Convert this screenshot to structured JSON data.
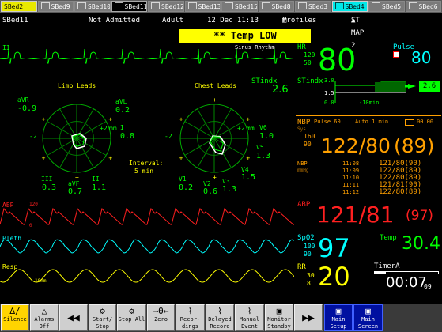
{
  "tabs": [
    {
      "label": "SBed2",
      "style": "yellow"
    },
    {
      "label": "SBed9",
      "style": "gray"
    },
    {
      "label": "SBed10",
      "style": "gray"
    },
    {
      "label": "SBed11",
      "style": "active"
    },
    {
      "label": "SBed12",
      "style": "gray"
    },
    {
      "label": "SBed13",
      "style": "gray"
    },
    {
      "label": "SBed15",
      "style": "gray"
    },
    {
      "label": "SBed8",
      "style": "gray"
    },
    {
      "label": "SBed3",
      "style": "gray"
    },
    {
      "label": "SBed4",
      "style": "cyan"
    },
    {
      "label": "SBed5",
      "style": "gray"
    },
    {
      "label": "SBed6",
      "style": "gray"
    }
  ],
  "status": {
    "bed": "SBed11",
    "admit": "Not Admitted",
    "category": "Adult",
    "datetime": "12 Dec 11:13",
    "profiles": "Profiles",
    "st_map": "ST MAP 2"
  },
  "alarm": "** Temp   LOW",
  "ecg": {
    "lead": "II",
    "rhythm": "Sinus Rhythm"
  },
  "st_map": {
    "limb_title": "Limb Leads",
    "chest_title": "Chest Leads",
    "avr_label": "aVR",
    "avr_val": "-0.9",
    "avl_label": "aVL",
    "avl_val": "0.2",
    "i_label": "I",
    "i_val": "0.8",
    "iii_label": "III",
    "iii_val": "0.3",
    "avf_label": "aVF",
    "avf_val": "0.7",
    "ii_label": "II",
    "ii_val": "1.1",
    "v1_label": "V1",
    "v1_val": "0.2",
    "v2_label": "V2",
    "v2_val": "0.6",
    "v3_label": "V3",
    "v3_val": "1.3",
    "v4_label": "V4",
    "v4_val": "1.5",
    "v5_label": "V5",
    "v5_val": "1.3",
    "v6_label": "V6",
    "v6_val": "1.0",
    "scale_neg": "-2",
    "scale_pos": "+2",
    "scale_unit": "mm",
    "interval_label": "Interval:",
    "interval_value": "5 min"
  },
  "hr": {
    "label": "HR",
    "high": "120",
    "low": "50",
    "value": "80"
  },
  "pulse": {
    "label": "Pulse",
    "value": "80"
  },
  "stindx": {
    "label": "STindx",
    "value": "2.6",
    "trend_label": "STindx",
    "trend_top": "3.0",
    "trend_mid": "1.5",
    "trend_bottom": "0.0",
    "trend_time": "-10min",
    "trend_value": "2.6"
  },
  "nbp": {
    "label": "NBP",
    "pulse": "Pulse 60",
    "mode": "Auto 1 min",
    "sys_label": "Sys.",
    "high": "160",
    "low": "90",
    "value": "122/80",
    "mean": "(89)",
    "timer_label": "00:00",
    "history_label": "NBP",
    "history_unit": "mmHg",
    "history": [
      {
        "time": "11:08",
        "value": "121/80(90)"
      },
      {
        "time": "11:09",
        "value": "122/80(89)"
      },
      {
        "time": "11:10",
        "value": "122/80(89)"
      },
      {
        "time": "11:11",
        "value": "121/81(90)"
      },
      {
        "time": "11:12",
        "value": "122/80(89)"
      }
    ]
  },
  "abp": {
    "wave_label": "ABP",
    "scale_top": "120",
    "scale_bottom": "0",
    "label": "ABP",
    "value": "121/81",
    "mean": "(97)"
  },
  "pleth": {
    "label": "Pleth"
  },
  "spo2": {
    "label": "SpO2",
    "high": "100",
    "low": "90",
    "value": "97"
  },
  "temp": {
    "label": "Temp",
    "value": "30.4"
  },
  "resp": {
    "wave_label": "Resp",
    "scale": "10mm",
    "label": "RR",
    "high": "30",
    "low": "8",
    "value": "20"
  },
  "timer": {
    "label": "TimerA",
    "value": "00:07",
    "sub": "09"
  },
  "toolbar": [
    {
      "icon": "∆∕",
      "label": "Silence",
      "style": "silence"
    },
    {
      "icon": "△",
      "label": "Alarms Off",
      "style": "gray"
    },
    {
      "icon": "◀◀",
      "label": "",
      "style": "arrow"
    },
    {
      "icon": "⚙",
      "label": "Start/ Stop",
      "style": "gray"
    },
    {
      "icon": "⚙",
      "label": "Stop All",
      "style": "gray"
    },
    {
      "icon": "→Θ←",
      "label": "Zero",
      "style": "gray"
    },
    {
      "icon": "⌇",
      "label": "Recor- dings",
      "style": "gray"
    },
    {
      "icon": "⌇",
      "label": "Delayed Record",
      "style": "gray"
    },
    {
      "icon": "⌇",
      "label": "Manual Event",
      "style": "gray"
    },
    {
      "icon": "▣",
      "label": "Monitor Standby",
      "style": "gray"
    },
    {
      "icon": "▶▶",
      "label": "",
      "style": "arrow"
    },
    {
      "icon": "▣",
      "label": "Main Setup",
      "style": "blue"
    },
    {
      "icon": "▣",
      "label": "Main Screen",
      "style": "blue"
    }
  ]
}
